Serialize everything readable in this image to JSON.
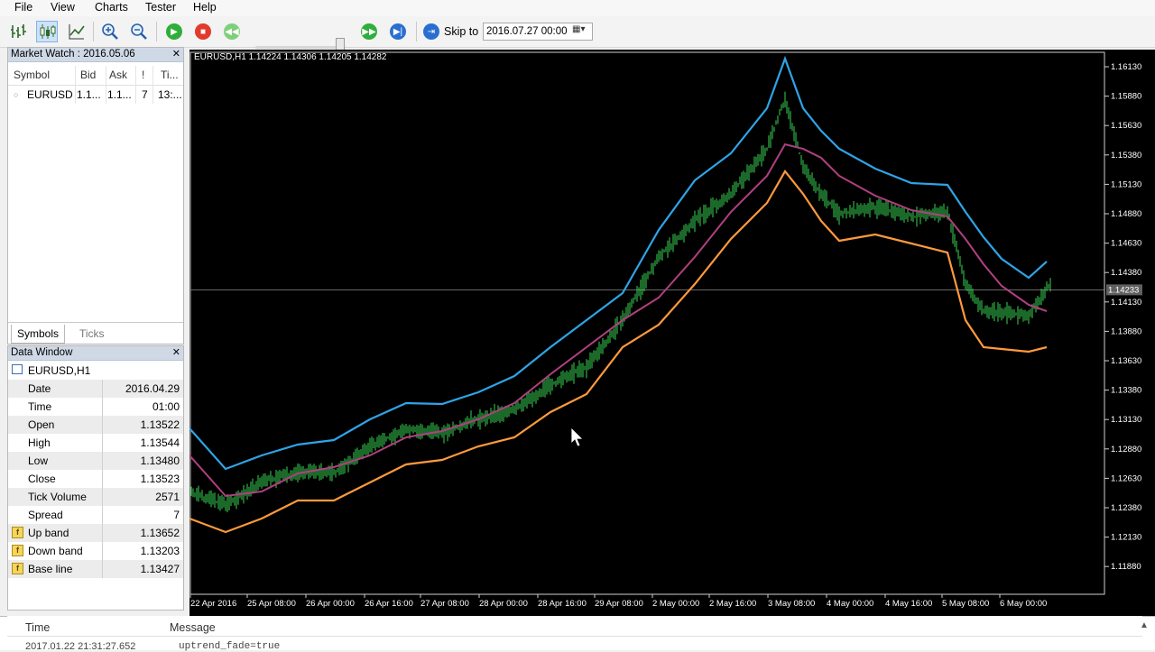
{
  "menu": [
    "File",
    "View",
    "Charts",
    "Tester",
    "Help"
  ],
  "toolbar": {
    "skip_to_label": "Skip to",
    "skip_to_value": "2016.07.27 00:00",
    "icons": [
      "bar-chart-icon",
      "candlestick-icon",
      "line-chart-icon",
      "zoom-in-icon",
      "zoom-out-icon",
      "play-icon",
      "stop-icon",
      "rewind-icon",
      "fast-forward-icon",
      "step-forward-icon",
      "skip-to-icon"
    ]
  },
  "market_watch": {
    "title": "Market Watch : 2016.05.06",
    "columns": [
      "Symbol",
      "Bid",
      "Ask",
      "!",
      "Ti..."
    ],
    "rows": [
      {
        "symbol": "EURUSD",
        "bid": "1.1...",
        "ask": "1.1...",
        "spread": "7",
        "time": "13:..."
      }
    ],
    "tabs": [
      "Symbols",
      "Ticks"
    ]
  },
  "data_window": {
    "title": "Data Window",
    "symbol": "EURUSD,H1",
    "rows": [
      {
        "label": "Date",
        "value": "2016.04.29"
      },
      {
        "label": "Time",
        "value": "01:00"
      },
      {
        "label": "Open",
        "value": "1.13522"
      },
      {
        "label": "High",
        "value": "1.13544"
      },
      {
        "label": "Low",
        "value": "1.13480"
      },
      {
        "label": "Close",
        "value": "1.13523"
      },
      {
        "label": "Tick Volume",
        "value": "2571"
      },
      {
        "label": "Spread",
        "value": "7"
      },
      {
        "label": "Up band",
        "value": "1.13652"
      },
      {
        "label": "Down band",
        "value": "1.13203"
      },
      {
        "label": "Base line",
        "value": "1.13427"
      }
    ]
  },
  "chart": {
    "header": "EURUSD,H1  1.14224 1.14306 1.14205 1.14282",
    "current_price": "1.14233",
    "price_labels": [
      "1.16130",
      "1.15880",
      "1.15630",
      "1.15380",
      "1.15130",
      "1.14880",
      "1.14630",
      "1.14380",
      "1.14130",
      "1.13880",
      "1.13630",
      "1.13380",
      "1.13130",
      "1.12880",
      "1.12630",
      "1.12380",
      "1.12130",
      "1.11880"
    ],
    "time_labels": [
      "22 Apr 2016",
      "25 Apr 08:00",
      "26 Apr 00:00",
      "26 Apr 16:00",
      "27 Apr 08:00",
      "28 Apr 00:00",
      "28 Apr 16:00",
      "29 Apr 08:00",
      "2 May 00:00",
      "2 May 16:00",
      "3 May 08:00",
      "4 May 00:00",
      "4 May 16:00",
      "5 May 08:00",
      "6 May 00:00"
    ],
    "colors": {
      "background": "#000000",
      "candles": "#39d353",
      "up_band": "#2fa4e7",
      "down_band": "#ff9a3c",
      "base_line": "#b04080"
    }
  },
  "bottom_panel": {
    "columns": [
      "Time",
      "Message"
    ],
    "row_time": "2017.01.22 21:31:27.652",
    "row_message": "uptrend_fade=true"
  }
}
